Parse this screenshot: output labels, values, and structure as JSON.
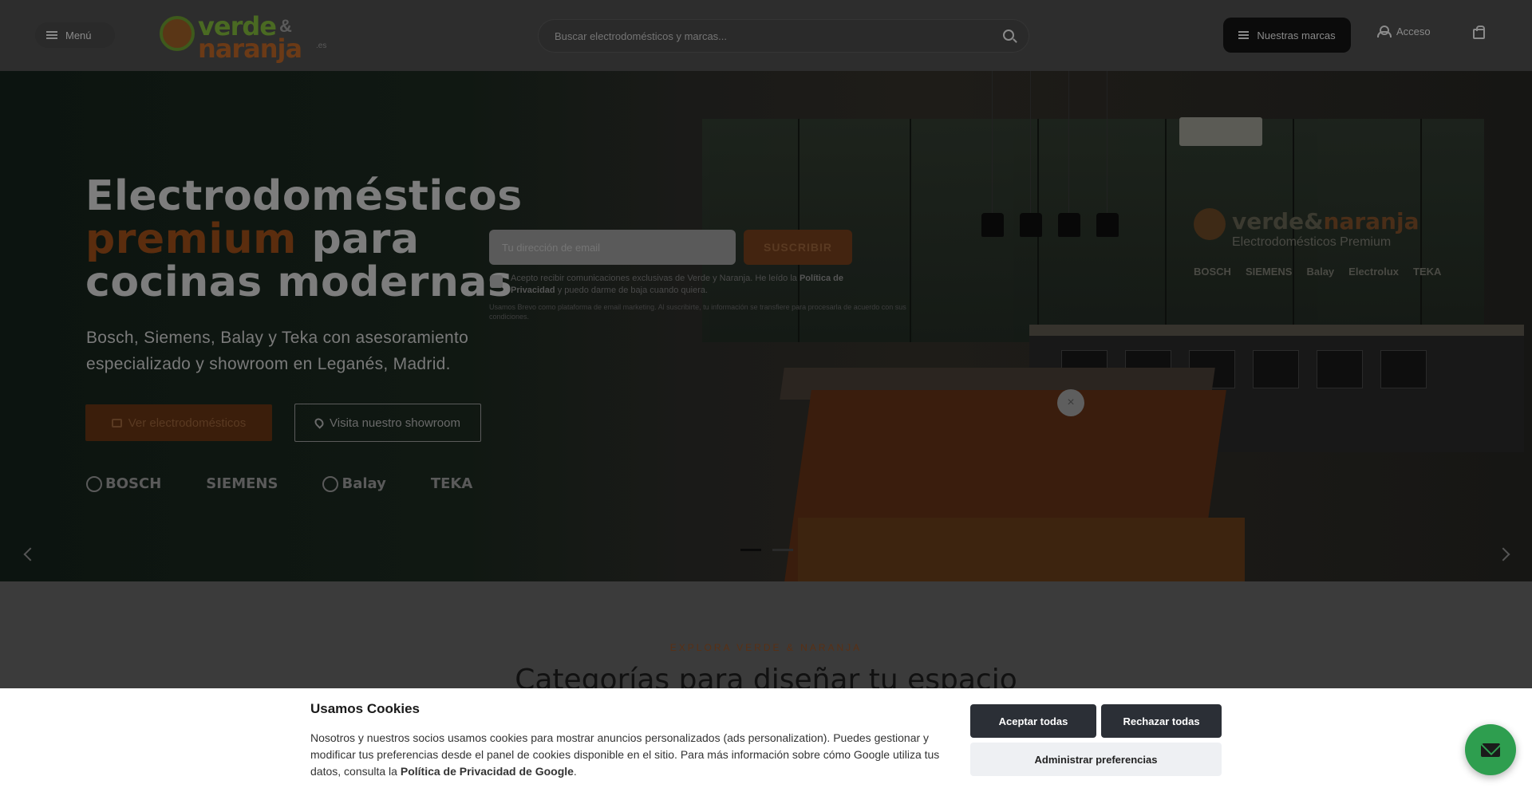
{
  "header": {
    "menu_label": "Menú",
    "logo_line1": "verde",
    "logo_amp": "&",
    "logo_line2": "naranja",
    "logo_tld": ".es",
    "search_placeholder": "Buscar electrodomésticos y marcas...",
    "brands_button": "Nuestras marcas",
    "login_label": "Acceso"
  },
  "hero": {
    "title_line1": "Electrodomésticos",
    "title_accent": "premium",
    "title_line2_rest": " para",
    "title_line3": "cocinas modernas",
    "subtitle": "Bosch, Siemens, Balay y Teka con asesoramiento especializado y showroom en Leganés, Madrid.",
    "primary_button": "Ver electrodomésticos",
    "secondary_button": "Visita nuestro showroom",
    "brands": [
      "BOSCH",
      "SIEMENS",
      "Balay",
      "TEKA"
    ],
    "right_logo": {
      "name_a": "verde",
      "name_amp": "&",
      "name_b": "naranja",
      "tagline": "Electrodomésticos Premium",
      "brands": [
        "BOSCH",
        "SIEMENS",
        "Balay",
        "Electrolux",
        "TEKA"
      ]
    },
    "close_label": "×",
    "slides_total": 2,
    "active_slide": 1
  },
  "newsletter": {
    "email_placeholder": "Tu dirección de email",
    "submit_label": "SUSCRIBIR",
    "consent_text": "Acepto recibir comunicaciones exclusivas de Verde y Naranja. He leído la ",
    "consent_link": "Política de Privacidad",
    "consent_tail": " y puedo darme de baja cuando quiera.",
    "fine_print": "Usamos Brevo como plataforma de email marketing. Al suscribirte, tu información se transfiere para procesarla de acuerdo con sus condiciones."
  },
  "section": {
    "eyebrow": "EXPLORA VERDE & NARANJA",
    "title": "Categorías para diseñar tu espacio"
  },
  "cookies": {
    "title": "Usamos Cookies",
    "body": "Nosotros y nuestros socios usamos cookies para mostrar anuncios personalizados (ads personalization). Puedes gestionar y modificar tus preferencias desde el panel de cookies disponible en el sitio. Para más información sobre cómo Google utiliza tus datos, consulta la ",
    "link": "Política de Privacidad de Google",
    "body_end": ".",
    "accept": "Aceptar todas",
    "reject": "Rechazar todas",
    "manage": "Administrar preferencias"
  },
  "colors": {
    "accent_orange": "#e8741e",
    "cookie_button_dark": "#2b2f36",
    "chat_green": "#2e9e4f"
  },
  "icons": [
    "menu-icon",
    "search-icon",
    "list-icon",
    "user-icon",
    "cart-icon",
    "calendar-icon",
    "map-pin-icon",
    "chevron-left-icon",
    "chevron-right-icon",
    "close-icon",
    "mail-icon"
  ]
}
